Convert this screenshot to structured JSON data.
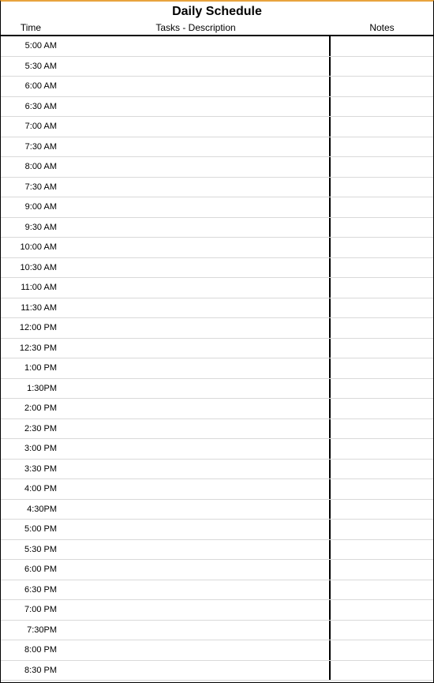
{
  "title": "Daily Schedule",
  "headers": {
    "time": "Time",
    "tasks": "Tasks - Description",
    "notes": "Notes"
  },
  "rows": [
    {
      "time": "5:00 AM",
      "tasks": "",
      "notes": ""
    },
    {
      "time": "5:30 AM",
      "tasks": "",
      "notes": ""
    },
    {
      "time": "6:00 AM",
      "tasks": "",
      "notes": ""
    },
    {
      "time": "6:30 AM",
      "tasks": "",
      "notes": ""
    },
    {
      "time": "7:00 AM",
      "tasks": "",
      "notes": ""
    },
    {
      "time": "7:30 AM",
      "tasks": "",
      "notes": ""
    },
    {
      "time": "8:00 AM",
      "tasks": "",
      "notes": ""
    },
    {
      "time": "7:30 AM",
      "tasks": "",
      "notes": ""
    },
    {
      "time": "9:00 AM",
      "tasks": "",
      "notes": ""
    },
    {
      "time": "9:30 AM",
      "tasks": "",
      "notes": ""
    },
    {
      "time": "10:00 AM",
      "tasks": "",
      "notes": ""
    },
    {
      "time": "10:30 AM",
      "tasks": "",
      "notes": ""
    },
    {
      "time": "11:00 AM",
      "tasks": "",
      "notes": ""
    },
    {
      "time": "11:30 AM",
      "tasks": "",
      "notes": ""
    },
    {
      "time": "12:00 PM",
      "tasks": "",
      "notes": ""
    },
    {
      "time": "12:30 PM",
      "tasks": "",
      "notes": ""
    },
    {
      "time": "1:00 PM",
      "tasks": "",
      "notes": ""
    },
    {
      "time": "1:30PM",
      "tasks": "",
      "notes": ""
    },
    {
      "time": "2:00 PM",
      "tasks": "",
      "notes": ""
    },
    {
      "time": "2:30 PM",
      "tasks": "",
      "notes": ""
    },
    {
      "time": "3:00 PM",
      "tasks": "",
      "notes": ""
    },
    {
      "time": "3:30 PM",
      "tasks": "",
      "notes": ""
    },
    {
      "time": "4:00 PM",
      "tasks": "",
      "notes": ""
    },
    {
      "time": "4:30PM",
      "tasks": "",
      "notes": ""
    },
    {
      "time": "5:00 PM",
      "tasks": "",
      "notes": ""
    },
    {
      "time": "5:30 PM",
      "tasks": "",
      "notes": ""
    },
    {
      "time": "6:00 PM",
      "tasks": "",
      "notes": ""
    },
    {
      "time": "6:30 PM",
      "tasks": "",
      "notes": ""
    },
    {
      "time": "7:00 PM",
      "tasks": "",
      "notes": ""
    },
    {
      "time": "7:30PM",
      "tasks": "",
      "notes": ""
    },
    {
      "time": "8:00 PM",
      "tasks": "",
      "notes": ""
    },
    {
      "time": "8:30 PM",
      "tasks": "",
      "notes": ""
    }
  ]
}
